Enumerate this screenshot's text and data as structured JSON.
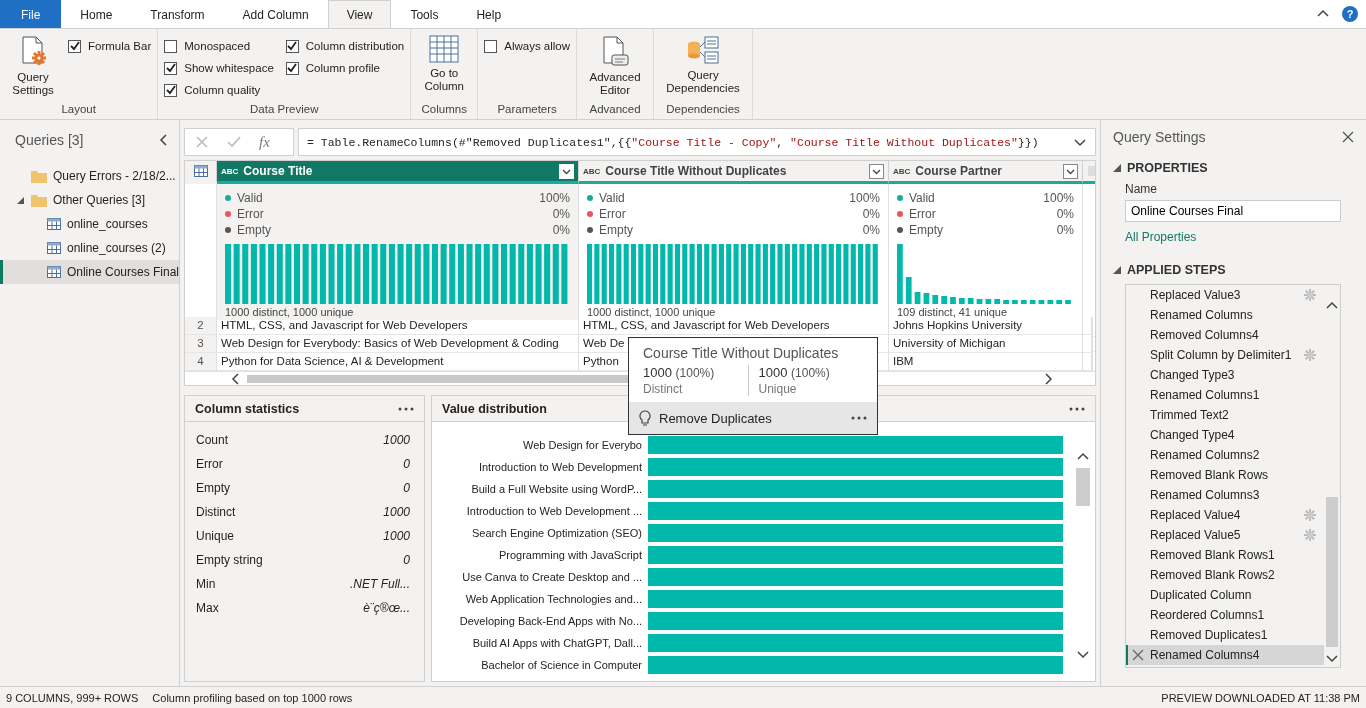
{
  "tabs": [
    {
      "label": "File",
      "kind": "file",
      "selected": false
    },
    {
      "label": "Home",
      "kind": "tab",
      "selected": false
    },
    {
      "label": "Transform",
      "kind": "tab",
      "selected": false
    },
    {
      "label": "Add Column",
      "kind": "tab",
      "selected": false
    },
    {
      "label": "View",
      "kind": "tab",
      "selected": true
    },
    {
      "label": "Tools",
      "kind": "tab",
      "selected": false
    },
    {
      "label": "Help",
      "kind": "tab",
      "selected": false
    }
  ],
  "help_button": "?",
  "ribbon": [
    {
      "label": "Layout",
      "items": [
        {
          "kind": "button",
          "label": "Query Settings"
        },
        {
          "kind": "checkbox",
          "label": "Formula Bar",
          "checked": true
        }
      ]
    },
    {
      "label": "Data Preview",
      "items": [
        {
          "kind": "checkbox",
          "label": "Monospaced",
          "checked": false
        },
        {
          "kind": "checkbox",
          "label": "Show whitespace",
          "checked": true
        },
        {
          "kind": "checkbox",
          "label": "Column quality",
          "checked": true
        },
        {
          "kind": "checkbox",
          "label": "Column distribution",
          "checked": true
        },
        {
          "kind": "checkbox",
          "label": "Column profile",
          "checked": true
        }
      ]
    },
    {
      "label": "Columns",
      "items": [
        {
          "kind": "button",
          "label": "Go to Column"
        }
      ]
    },
    {
      "label": "Parameters",
      "items": [
        {
          "kind": "checkbox",
          "label": "Always allow",
          "checked": false
        }
      ]
    },
    {
      "label": "Advanced",
      "items": [
        {
          "kind": "button",
          "label": "Advanced Editor"
        }
      ]
    },
    {
      "label": "Dependencies",
      "items": [
        {
          "kind": "button",
          "label": "Query Dependencies"
        }
      ]
    }
  ],
  "queries": {
    "title": "Queries [3]",
    "items": [
      {
        "kind": "folder",
        "label": "Query Errors - 2/18/2...",
        "selected": false
      },
      {
        "kind": "folder",
        "label": "Other Queries [3]",
        "expanded": true,
        "selected": false,
        "children": [
          {
            "kind": "table",
            "label": "online_courses",
            "selected": false
          },
          {
            "kind": "table",
            "label": "online_courses (2)",
            "selected": false
          },
          {
            "kind": "table",
            "label": "Online Courses Final",
            "selected": true
          }
        ]
      }
    ]
  },
  "formula_bar": {
    "function_label": "fx",
    "formula": [
      {
        "kind": "code",
        "text": "= Table.RenameColumns(#\"Removed Duplicates1\",{{"
      },
      {
        "kind": "string",
        "text": "\"Course Title - Copy\""
      },
      {
        "kind": "code",
        "text": ", "
      },
      {
        "kind": "string",
        "text": "\"Course Title Without Duplicates\""
      },
      {
        "kind": "code",
        "text": "}})"
      }
    ]
  },
  "table": {
    "columns": [
      {
        "name": "Course Title",
        "type_label": "ABC",
        "selected": true,
        "kind": "uniform",
        "summary": "1000 distinct, 1000 unique",
        "quality": [
          {
            "label": "Valid",
            "value": "100%",
            "color": "#1aab9b"
          },
          {
            "label": "Error",
            "value": "0%",
            "color": "#e8575a"
          },
          {
            "label": "Empty",
            "value": "0%",
            "color": "#555555"
          }
        ]
      },
      {
        "name": "Course Title Without Duplicates",
        "type_label": "ABC",
        "selected": false,
        "kind": "uniform",
        "summary": "1000 distinct, 1000 unique",
        "quality": [
          {
            "label": "Valid",
            "value": "100%",
            "color": "#1aab9b"
          },
          {
            "label": "Error",
            "value": "0%",
            "color": "#e8575a"
          },
          {
            "label": "Empty",
            "value": "0%",
            "color": "#555555"
          }
        ]
      },
      {
        "name": "Course Partner",
        "type_label": "ABC",
        "selected": false,
        "kind": "skewed",
        "summary": "109 distinct, 41 unique",
        "quality": [
          {
            "label": "Valid",
            "value": "100%",
            "color": "#1aab9b"
          },
          {
            "label": "Error",
            "value": "0%",
            "color": "#e8575a"
          },
          {
            "label": "Empty",
            "value": "0%",
            "color": "#555555"
          }
        ]
      }
    ],
    "rows": [
      {
        "number": "2",
        "cells": [
          "HTML, CSS, and Javascript for Web Developers",
          "HTML, CSS, and Javascript for Web Developers",
          "Johns Hopkins University"
        ]
      },
      {
        "number": "3",
        "cells": [
          "Web Design for Everybody: Basics of Web Development & Coding",
          "Web De",
          "University of Michigan"
        ]
      },
      {
        "number": "4",
        "cells": [
          "Python for Data Science, AI & Development",
          "Python",
          "IBM"
        ]
      }
    ]
  },
  "tooltip": {
    "title": "Course Title Without Duplicates",
    "stats": [
      {
        "value": "1000",
        "percent": "(100%)",
        "label": "Distinct"
      },
      {
        "value": "1000",
        "percent": "(100%)",
        "label": "Unique"
      }
    ],
    "action": "Remove Duplicates"
  },
  "column_statistics": {
    "title": "Column statistics",
    "rows": [
      {
        "label": "Count",
        "value": "1000"
      },
      {
        "label": "Error",
        "value": "0"
      },
      {
        "label": "Empty",
        "value": "0"
      },
      {
        "label": "Distinct",
        "value": "1000"
      },
      {
        "label": "Unique",
        "value": "1000"
      },
      {
        "label": "Empty string",
        "value": "0"
      },
      {
        "label": "Min",
        "value": ".NET Full..."
      },
      {
        "label": "Max",
        "value": "è¨ç®œ..."
      }
    ]
  },
  "value_distribution": {
    "title": "Value distribution",
    "labels": [
      "Web Design for Everybo",
      "Introduction to Web Development",
      "Build a Full Website using WordP...",
      "Introduction to Web Development ...",
      "Search Engine Optimization (SEO)",
      "Programming with JavaScript",
      "Use Canva to Create Desktop and ...",
      "Web Application Technologies and...",
      "Developing Back-End Apps with No...",
      "Build AI Apps with ChatGPT, Dall...",
      "Bachelor of Science in Computer"
    ]
  },
  "query_settings": {
    "title": "Query Settings",
    "properties_heading": "PROPERTIES",
    "name_label": "Name",
    "name_value": "Online Courses Final",
    "all_properties": "All Properties",
    "steps_heading": "APPLIED STEPS",
    "steps": [
      {
        "label": "Replaced Value3",
        "has_settings": true,
        "selected": false
      },
      {
        "label": "Renamed Columns",
        "has_settings": false,
        "selected": false
      },
      {
        "label": "Removed Columns4",
        "has_settings": false,
        "selected": false
      },
      {
        "label": "Split Column by Delimiter1",
        "has_settings": true,
        "selected": false
      },
      {
        "label": "Changed Type3",
        "has_settings": false,
        "selected": false
      },
      {
        "label": "Renamed Columns1",
        "has_settings": false,
        "selected": false
      },
      {
        "label": "Trimmed Text2",
        "has_settings": false,
        "selected": false
      },
      {
        "label": "Changed Type4",
        "has_settings": false,
        "selected": false
      },
      {
        "label": "Renamed Columns2",
        "has_settings": false,
        "selected": false
      },
      {
        "label": "Removed Blank Rows",
        "has_settings": false,
        "selected": false
      },
      {
        "label": "Renamed Columns3",
        "has_settings": false,
        "selected": false
      },
      {
        "label": "Replaced Value4",
        "has_settings": true,
        "selected": false
      },
      {
        "label": "Replaced Value5",
        "has_settings": true,
        "selected": false
      },
      {
        "label": "Removed Blank Rows1",
        "has_settings": false,
        "selected": false
      },
      {
        "label": "Removed Blank Rows2",
        "has_settings": false,
        "selected": false
      },
      {
        "label": "Duplicated Column",
        "has_settings": false,
        "selected": false
      },
      {
        "label": "Reordered Columns1",
        "has_settings": false,
        "selected": false
      },
      {
        "label": "Removed Duplicates1",
        "has_settings": false,
        "selected": false
      },
      {
        "label": "Renamed Columns4",
        "has_settings": false,
        "selected": true
      }
    ]
  },
  "status_bar": {
    "left": [
      "9 COLUMNS, 999+ ROWS",
      "Column profiling based on top 1000 rows"
    ],
    "right": "PREVIEW DOWNLOADED AT 11:38 PM"
  }
}
